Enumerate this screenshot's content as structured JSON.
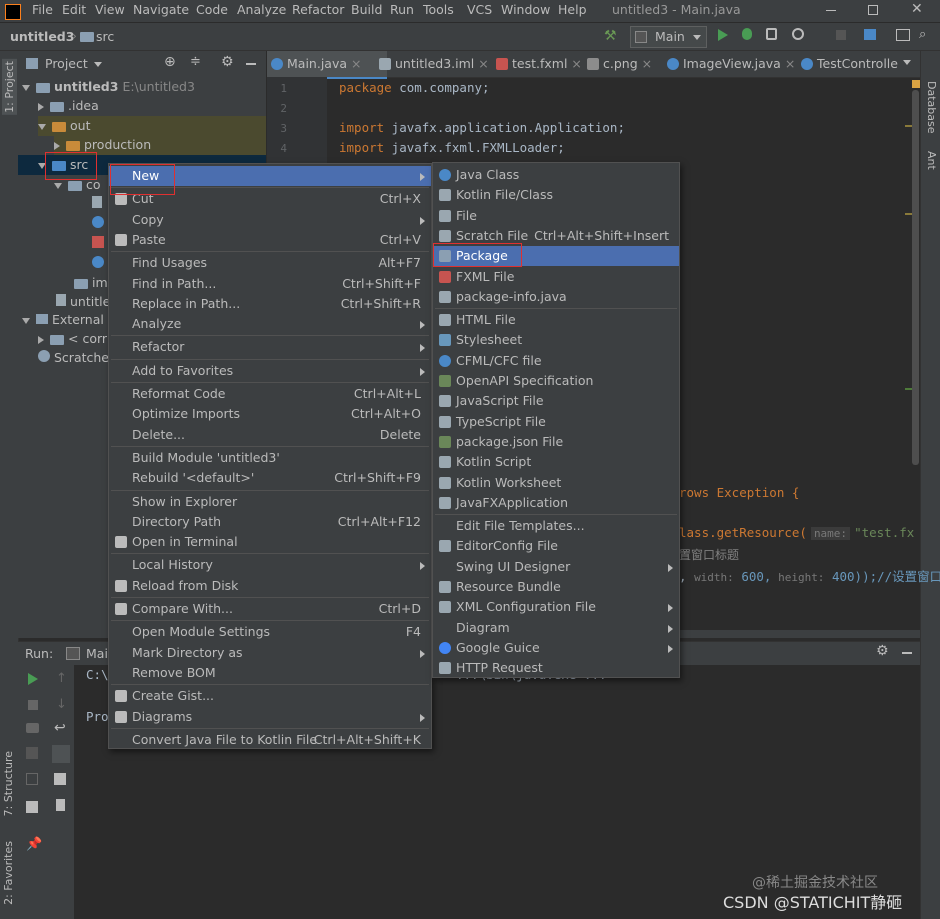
{
  "menubar": {
    "items": [
      "File",
      "Edit",
      "View",
      "Navigate",
      "Code",
      "Analyze",
      "Refactor",
      "Build",
      "Run",
      "Tools",
      "VCS",
      "Window",
      "Help"
    ],
    "window_title": "untitled3 - Main.java"
  },
  "navbar": {
    "breadcrumb_project": "untitled3",
    "breadcrumb_folder": "src",
    "run_config": "Main"
  },
  "project_panel": {
    "header": "Project",
    "tree": [
      {
        "label": "untitled3",
        "path": "E:\\untitled3"
      },
      {
        "label": ".idea"
      },
      {
        "label": "out"
      },
      {
        "label": "production"
      },
      {
        "label": "src"
      },
      {
        "label": "co"
      },
      {
        "label": "ima"
      },
      {
        "label": "untitle"
      },
      {
        "label": "External l"
      },
      {
        "label": "< corr"
      },
      {
        "label": "Scratches"
      }
    ]
  },
  "tabs": [
    {
      "label": "Main.java",
      "color": "#4a88c7"
    },
    {
      "label": "untitled3.iml",
      "color": "#9aa7b0"
    },
    {
      "label": "test.fxml",
      "color": "#c75450"
    },
    {
      "label": "c.png",
      "color": "#8c8c8c"
    },
    {
      "label": "ImageView.java",
      "color": "#4a88c7"
    },
    {
      "label": "TestControlle",
      "color": "#4a88c7"
    }
  ],
  "editor": {
    "line_numbers": [
      "1",
      "2",
      "3",
      "4"
    ],
    "lines": [
      {
        "kw": "package",
        "rest": " com.company;"
      },
      {
        "kw": "",
        "rest": ""
      },
      {
        "kw": "import",
        "rest": " javafx.application.Application;"
      },
      {
        "kw": "import",
        "rest": " javafx.fxml.FXMLLoader;"
      }
    ],
    "frag1": "rows Exception {",
    "frag2_a": "lass.getResource(",
    "frag2_hint": "name:",
    "frag2_b": "\"test.fx",
    "frag3": "置窗口标题",
    "frag4_a": ", ",
    "frag4_hint1": "width:",
    "frag4_v1": " 600,",
    "frag4_hint2": " height:",
    "frag4_v2": " 400));//设置窗口"
  },
  "run_panel": {
    "label": "Run:",
    "tab": "Mai",
    "out1": "C:\\",
    "out1b": "...\\bin\\java.exe ...",
    "out2": "Pro"
  },
  "left_strip": {
    "project": "1: Project",
    "structure": "7: Structure",
    "favorites": "2: Favorites"
  },
  "right_strip": {
    "database": "Database",
    "ant": "Ant"
  },
  "context_menu": {
    "groups": [
      [
        {
          "label": "New",
          "submenu": true,
          "selected": true
        }
      ],
      [
        {
          "label": "Cut",
          "shortcut": "Ctrl+X",
          "icon": "scissors-icon"
        },
        {
          "label": "Copy",
          "submenu": true
        },
        {
          "label": "Paste",
          "shortcut": "Ctrl+V",
          "icon": "clipboard-icon"
        }
      ],
      [
        {
          "label": "Find Usages",
          "shortcut": "Alt+F7"
        },
        {
          "label": "Find in Path...",
          "shortcut": "Ctrl+Shift+F"
        },
        {
          "label": "Replace in Path...",
          "shortcut": "Ctrl+Shift+R"
        },
        {
          "label": "Analyze",
          "submenu": true
        }
      ],
      [
        {
          "label": "Refactor",
          "submenu": true
        }
      ],
      [
        {
          "label": "Add to Favorites",
          "submenu": true
        }
      ],
      [
        {
          "label": "Reformat Code",
          "shortcut": "Ctrl+Alt+L"
        },
        {
          "label": "Optimize Imports",
          "shortcut": "Ctrl+Alt+O"
        },
        {
          "label": "Delete...",
          "shortcut": "Delete"
        }
      ],
      [
        {
          "label": "Build Module 'untitled3'"
        },
        {
          "label": "Rebuild '<default>'",
          "shortcut": "Ctrl+Shift+F9"
        }
      ],
      [
        {
          "label": "Show in Explorer"
        },
        {
          "label": "Directory Path",
          "shortcut": "Ctrl+Alt+F12"
        },
        {
          "label": "Open in Terminal",
          "icon": "terminal-icon"
        }
      ],
      [
        {
          "label": "Local History",
          "submenu": true
        },
        {
          "label": "Reload from Disk",
          "icon": "reload-icon"
        }
      ],
      [
        {
          "label": "Compare With...",
          "shortcut": "Ctrl+D",
          "icon": "compare-icon"
        }
      ],
      [
        {
          "label": "Open Module Settings",
          "shortcut": "F4"
        },
        {
          "label": "Mark Directory as",
          "submenu": true
        },
        {
          "label": "Remove BOM"
        }
      ],
      [
        {
          "label": "Create Gist...",
          "icon": "github-icon"
        },
        {
          "label": "Diagrams",
          "submenu": true,
          "icon": "diagram-icon"
        }
      ],
      [
        {
          "label": "Convert Java File to Kotlin File",
          "shortcut": "Ctrl+Alt+Shift+K"
        }
      ]
    ]
  },
  "new_submenu": {
    "groups": [
      [
        {
          "label": "Java Class",
          "icon": "java-class-icon",
          "color": "#4a88c7"
        },
        {
          "label": "Kotlin File/Class",
          "icon": "kotlin-icon",
          "color": "#9aa7b0"
        },
        {
          "label": "File",
          "icon": "file-icon",
          "color": "#9aa7b0"
        },
        {
          "label": "Scratch File",
          "shortcut": "Ctrl+Alt+Shift+Insert",
          "icon": "scratch-icon",
          "color": "#9aa7b0"
        },
        {
          "label": "Package",
          "icon": "package-icon",
          "color": "#8b9fb2",
          "selected": true
        },
        {
          "label": "FXML File",
          "icon": "fxml-icon",
          "color": "#c75450"
        },
        {
          "label": "package-info.java",
          "icon": "java-file-icon",
          "color": "#9aa7b0"
        }
      ],
      [
        {
          "label": "HTML File",
          "icon": "html-icon",
          "color": "#9aa7b0"
        },
        {
          "label": "Stylesheet",
          "icon": "css-icon",
          "color": "#6897bb"
        },
        {
          "label": "CFML/CFC file",
          "icon": "cfml-icon",
          "color": "#4a88c7"
        },
        {
          "label": "OpenAPI Specification",
          "icon": "openapi-icon",
          "color": "#6a8759"
        },
        {
          "label": "JavaScript File",
          "icon": "js-icon",
          "color": "#9aa7b0"
        },
        {
          "label": "TypeScript File",
          "icon": "ts-icon",
          "color": "#9aa7b0"
        },
        {
          "label": "package.json File",
          "icon": "npm-icon",
          "color": "#6a8759"
        },
        {
          "label": "Kotlin Script",
          "icon": "kotlin-script-icon",
          "color": "#9aa7b0"
        },
        {
          "label": "Kotlin Worksheet",
          "icon": "kotlin-worksheet-icon",
          "color": "#9aa7b0"
        },
        {
          "label": "JavaFXApplication",
          "icon": "javafx-icon",
          "color": "#9aa7b0"
        }
      ],
      [
        {
          "label": "Edit File Templates..."
        },
        {
          "label": "EditorConfig File",
          "icon": "gear-icon",
          "color": "#9aa7b0"
        },
        {
          "label": "Swing UI Designer",
          "submenu": true
        },
        {
          "label": "Resource Bundle",
          "icon": "bundle-icon",
          "color": "#9aa7b0"
        },
        {
          "label": "XML Configuration File",
          "submenu": true,
          "icon": "xml-icon",
          "color": "#9aa7b0"
        },
        {
          "label": "Diagram",
          "submenu": true
        },
        {
          "label": "Google Guice",
          "submenu": true,
          "icon": "google-icon",
          "color": "#4285f4"
        },
        {
          "label": "HTTP Request",
          "icon": "http-icon",
          "color": "#9aa7b0"
        }
      ]
    ]
  },
  "watermark": {
    "line1": "@稀土掘金技术社区",
    "line2": "CSDN @STATICHIT静砸"
  }
}
